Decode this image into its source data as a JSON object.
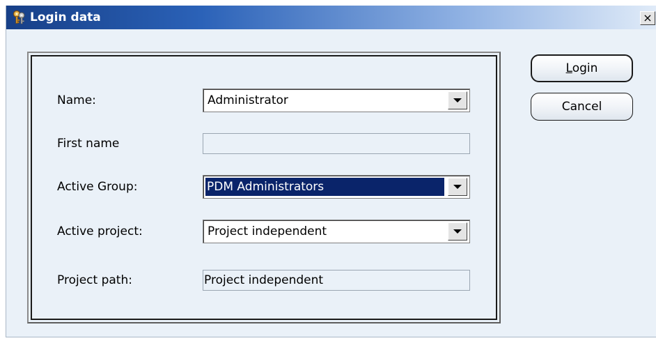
{
  "window": {
    "title": "Login data",
    "close_label": "×"
  },
  "buttons": {
    "login_label": "Login",
    "cancel_label": "Cancel"
  },
  "form": {
    "name": {
      "label": "Name:",
      "value": "Administrator"
    },
    "first_name": {
      "label": "First name",
      "value": ""
    },
    "active_group": {
      "label": "Active Group:",
      "value": "PDM Administrators"
    },
    "active_project": {
      "label": "Active project:",
      "value": "Project independent"
    },
    "project_path": {
      "label": "Project path:",
      "value": "Project independent"
    }
  },
  "icons": {
    "title": "keys-icon",
    "dropdown": "chevron-down-icon"
  },
  "colors": {
    "title_bar_dark": "#173f87",
    "title_bar_light": "#e0ebf8",
    "selection": "#0a246a",
    "dialog_bg": "#eaf1f8"
  }
}
